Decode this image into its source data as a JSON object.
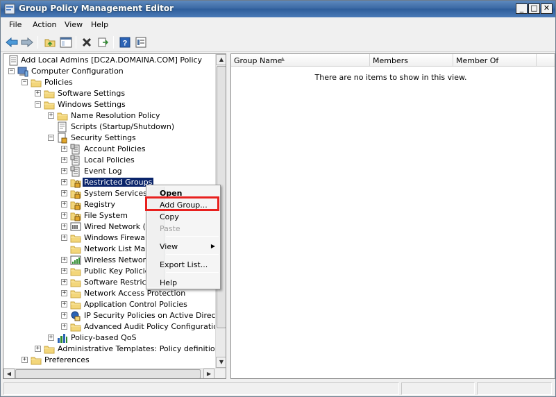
{
  "window": {
    "title": "Group Policy Management Editor",
    "controls": {
      "minimize": "_",
      "restore": "□",
      "close": "✕"
    }
  },
  "menubar": [
    {
      "label": "File"
    },
    {
      "label": "Action"
    },
    {
      "label": "View"
    },
    {
      "label": "Help"
    }
  ],
  "toolbar": [
    {
      "icon": "back-arrow-icon"
    },
    {
      "icon": "forward-arrow-icon"
    },
    {
      "icon": "up-folder-icon"
    },
    {
      "icon": "show-hide-console-tree-icon"
    },
    {
      "icon": "delete-icon"
    },
    {
      "icon": "export-list-icon"
    },
    {
      "icon": "help-icon"
    },
    {
      "icon": "properties-icon"
    }
  ],
  "tree": {
    "nodes": [
      {
        "label": "Add Local Admins [DC2A.DOMAINA.COM] Policy",
        "icon": "policy-document-icon",
        "expander": "",
        "selected": false
      },
      {
        "label": "Computer Configuration",
        "icon": "computer-icon",
        "expander": "−",
        "selected": false
      },
      {
        "label": "Policies",
        "icon": "folder-icon",
        "expander": "−",
        "selected": false
      },
      {
        "label": "Software Settings",
        "icon": "folder-icon",
        "expander": "+",
        "selected": false
      },
      {
        "label": "Windows Settings",
        "icon": "folder-icon",
        "expander": "−",
        "selected": false
      },
      {
        "label": "Name Resolution Policy",
        "icon": "folder-icon",
        "expander": "+",
        "selected": false
      },
      {
        "label": "Scripts (Startup/Shutdown)",
        "icon": "script-icon",
        "expander": "",
        "selected": false
      },
      {
        "label": "Security Settings",
        "icon": "security-settings-icon",
        "expander": "−",
        "selected": false
      },
      {
        "label": "Account Policies",
        "icon": "policy-list-icon",
        "expander": "+",
        "selected": false
      },
      {
        "label": "Local Policies",
        "icon": "policy-list-icon",
        "expander": "+",
        "selected": false
      },
      {
        "label": "Event Log",
        "icon": "policy-list-icon",
        "expander": "+",
        "selected": false
      },
      {
        "label": "Restricted Groups",
        "icon": "locked-folder-icon",
        "expander": "+",
        "selected": true
      },
      {
        "label": "System Services",
        "icon": "locked-folder-icon",
        "expander": "+",
        "selected": false
      },
      {
        "label": "Registry",
        "icon": "locked-folder-icon",
        "expander": "+",
        "selected": false
      },
      {
        "label": "File System",
        "icon": "locked-folder-icon",
        "expander": "+",
        "selected": false
      },
      {
        "label": "Wired Network (IE",
        "icon": "wired-network-icon",
        "expander": "+",
        "selected": false
      },
      {
        "label": "Windows Firewall",
        "icon": "folder-icon",
        "expander": "+",
        "selected": false
      },
      {
        "label": "Network List Mana",
        "icon": "folder-icon",
        "expander": "",
        "selected": false
      },
      {
        "label": "Wireless Network",
        "icon": "wireless-network-icon",
        "expander": "+",
        "selected": false
      },
      {
        "label": "Public Key Policies",
        "icon": "folder-icon",
        "expander": "+",
        "selected": false
      },
      {
        "label": "Software Restricti",
        "icon": "folder-icon",
        "expander": "+",
        "selected": false
      },
      {
        "label": "Network Access Protection",
        "icon": "folder-icon",
        "expander": "+",
        "selected": false
      },
      {
        "label": "Application Control Policies",
        "icon": "folder-icon",
        "expander": "+",
        "selected": false
      },
      {
        "label": "IP Security Policies on Active Directory",
        "icon": "ip-security-icon",
        "expander": "+",
        "selected": false
      },
      {
        "label": "Advanced Audit Policy Configuration",
        "icon": "folder-icon",
        "expander": "+",
        "selected": false
      },
      {
        "label": "Policy-based QoS",
        "icon": "qos-chart-icon",
        "expander": "+",
        "selected": false
      },
      {
        "label": "Administrative Templates: Policy definitions (AI",
        "icon": "folder-icon",
        "expander": "+",
        "selected": false
      },
      {
        "label": "Preferences",
        "icon": "folder-icon",
        "expander": "+",
        "selected": false
      }
    ]
  },
  "list": {
    "columns": [
      {
        "label": "Group Name",
        "sorted": true
      },
      {
        "label": "Members",
        "sorted": false
      },
      {
        "label": "Member Of",
        "sorted": false
      }
    ],
    "empty_message": "There are no items to show in this view."
  },
  "context_menu": {
    "items": [
      {
        "label": "Open",
        "bold": true,
        "disabled": false,
        "submenu": false
      },
      {
        "label": "Add Group...",
        "bold": false,
        "disabled": false,
        "submenu": false,
        "highlighted": true
      },
      {
        "label": "Copy",
        "bold": false,
        "disabled": false,
        "submenu": false
      },
      {
        "label": "Paste",
        "bold": false,
        "disabled": true,
        "submenu": false
      },
      {
        "label": "View",
        "bold": false,
        "disabled": false,
        "submenu": true
      },
      {
        "label": "Export List...",
        "bold": false,
        "disabled": false,
        "submenu": false
      },
      {
        "label": "Help",
        "bold": false,
        "disabled": false,
        "submenu": false
      }
    ],
    "highlight_color": "#e8201e"
  },
  "colors": {
    "title_bar": "#3c6aa5",
    "selection": "#0a246a",
    "folder": "#f3d67a"
  }
}
